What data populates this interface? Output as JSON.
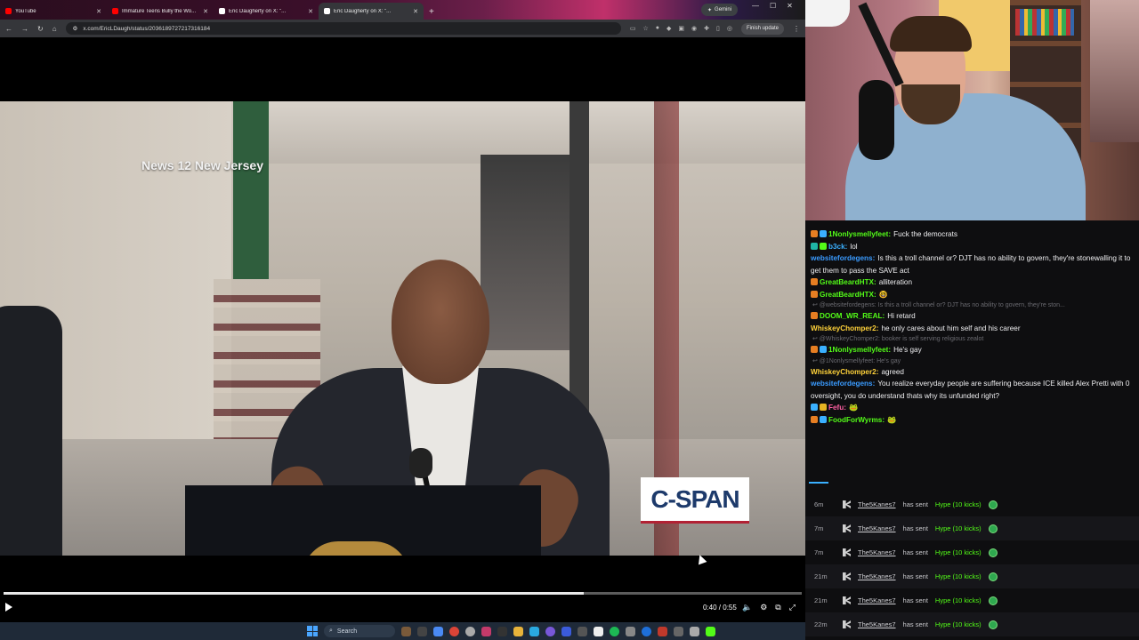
{
  "browser": {
    "tabs": [
      {
        "label": "YouTube",
        "favicon_color": "#ff0000",
        "active": false
      },
      {
        "label": "Immature Teens Bully the Wo...",
        "favicon_color": "#ff0000",
        "active": false
      },
      {
        "label": "Eric Daugherty on X: \"...",
        "favicon_color": "#ffffff",
        "active": false
      },
      {
        "label": "Eric Daugherty on X: \"...",
        "favicon_color": "#ffffff",
        "active": true
      }
    ],
    "new_tab_icon": "plus-icon",
    "gemini_label": "Gemini",
    "url": "x.com/EricLDaugh/status/2036189727217316184",
    "finish_update_label": "Finish update"
  },
  "video": {
    "overlay_text": "News 12 New Jersey",
    "logo_text": "C-SPAN",
    "current_time": "0:40",
    "duration": "0:55",
    "time_display": "0:40 / 0:55",
    "progress_fraction": 0.727
  },
  "taskbar": {
    "search_placeholder": "Search"
  },
  "chat": {
    "messages": [
      {
        "kind": "msg",
        "user": "1Nonlysmellyfeet:",
        "color": "#53fc18",
        "badges": [
          "#e67e22",
          "#3ab0ff"
        ],
        "text": "Fuck the democrats"
      },
      {
        "kind": "msg",
        "user": "b3ck:",
        "color": "#3ab0ff",
        "badges": [
          "#1fb5a5",
          "#53fc18"
        ],
        "text": "lol"
      },
      {
        "kind": "msg",
        "user": "websitefordegens:",
        "color": "#3a9bff",
        "badges": [],
        "text": "Is this a troll channel or? DJT has no ability to govern, they're stonewalling it to get them to pass the SAVE act"
      },
      {
        "kind": "msg",
        "user": "GreatBeardHTX:",
        "color": "#53fc18",
        "badges": [
          "#e67e22"
        ],
        "text": "alliteration"
      },
      {
        "kind": "msg",
        "user": "GreatBeardHTX:",
        "color": "#53fc18",
        "badges": [
          "#e67e22"
        ],
        "text": "🤓"
      },
      {
        "kind": "reply",
        "text": "@websitefordegens: Is this a troll channel or? DJT has no ability to govern, they're ston..."
      },
      {
        "kind": "msg",
        "user": "DOOM_WR_REAL:",
        "color": "#53fc18",
        "badges": [
          "#e67e22"
        ],
        "text": "Hi retard"
      },
      {
        "kind": "msg",
        "user": "WhiskeyChomper2:",
        "color": "#ffd23a",
        "badges": [],
        "text": "he only cares about him self and his career"
      },
      {
        "kind": "reply",
        "text": "@WhiskeyChomper2: booker is self serving religious zealot"
      },
      {
        "kind": "msg",
        "user": "1Nonlysmellyfeet:",
        "color": "#53fc18",
        "badges": [
          "#e67e22",
          "#3ab0ff"
        ],
        "text": "He's gay"
      },
      {
        "kind": "reply",
        "text": "@1Nonlysmellyfeet: He's gay"
      },
      {
        "kind": "msg",
        "user": "WhiskeyChomper2:",
        "color": "#ffd23a",
        "badges": [],
        "text": "agreed"
      },
      {
        "kind": "msg",
        "user": "websitefordegens:",
        "color": "#3a9bff",
        "badges": [],
        "text": "You realize everyday people are suffering because ICE killed Alex Pretti with 0 oversight, you do understand thats why its unfunded right?"
      },
      {
        "kind": "msg",
        "user": "Fefu:",
        "color": "#ff5fa2",
        "badges": [
          "#3ab0ff",
          "#e6b422"
        ],
        "text": "🐸"
      },
      {
        "kind": "msg",
        "user": "FoodForWyrms:",
        "color": "#53fc18",
        "badges": [
          "#e67e22",
          "#3ab0ff"
        ],
        "text": "🐸"
      }
    ],
    "events": [
      {
        "age": "6m",
        "user": "The5Kanes7",
        "mid": "has sent",
        "hype": "Hype (10 kicks)"
      },
      {
        "age": "7m",
        "user": "The5Kanes7",
        "mid": "has sent",
        "hype": "Hype (10 kicks)"
      },
      {
        "age": "7m",
        "user": "The5Kanes7",
        "mid": "has sent",
        "hype": "Hype (10 kicks)"
      },
      {
        "age": "21m",
        "user": "The5Kanes7",
        "mid": "has sent",
        "hype": "Hype (10 kicks)"
      },
      {
        "age": "21m",
        "user": "The5Kanes7",
        "mid": "has sent",
        "hype": "Hype (10 kicks)"
      },
      {
        "age": "22m",
        "user": "The5Kanes7",
        "mid": "has sent",
        "hype": "Hype (10 kicks)"
      }
    ]
  },
  "colors": {
    "hype_green": "#53fc18",
    "cspan_blue": "#1d3a6b",
    "cspan_red": "#b22234"
  }
}
